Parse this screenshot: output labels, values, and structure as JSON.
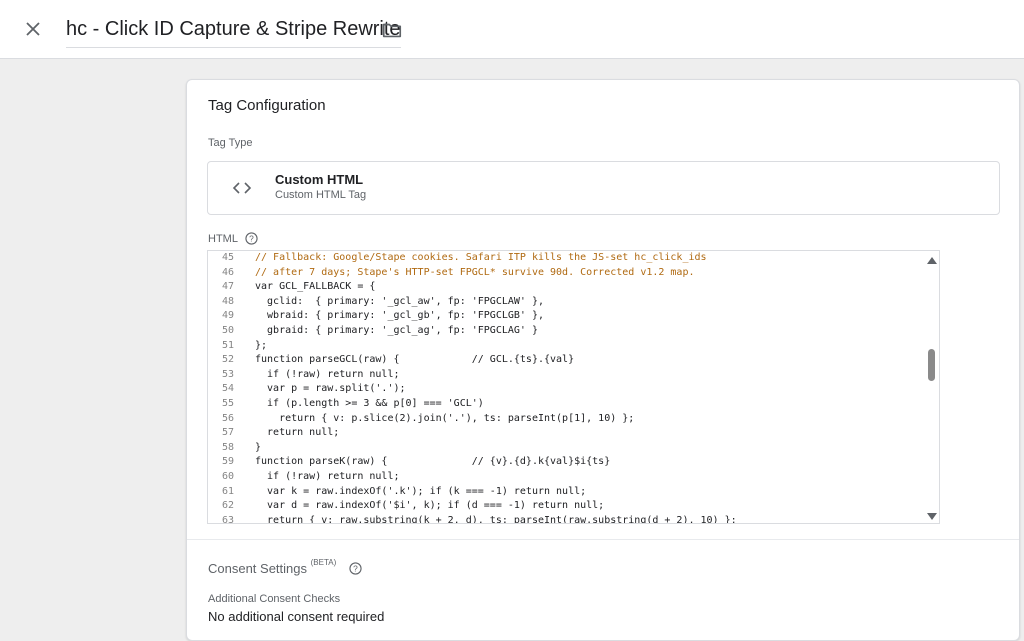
{
  "header": {
    "title": "hc - Click ID Capture & Stripe Rewrite",
    "close_icon": "close-icon",
    "folder_icon": "folder-icon"
  },
  "card": {
    "title": "Tag Configuration",
    "tag_type_label": "Tag Type",
    "tag_type": {
      "name": "Custom HTML",
      "subtitle": "Custom HTML Tag",
      "icon": "code-brackets-icon"
    },
    "html_label": "HTML",
    "editor": {
      "lines": [
        {
          "num": "45",
          "text": "// Fallback: Google/Stape cookies. Safari ITP kills the JS-set hc_click_ids",
          "comment": true
        },
        {
          "num": "46",
          "text": "// after 7 days; Stape's HTTP-set FPGCL* survive 90d. Corrected v1.2 map.",
          "comment": true
        },
        {
          "num": "47",
          "text": "var GCL_FALLBACK = {",
          "comment": false
        },
        {
          "num": "48",
          "text": "  gclid:  { primary: '_gcl_aw', fp: 'FPGCLAW' },",
          "comment": false
        },
        {
          "num": "49",
          "text": "  wbraid: { primary: '_gcl_gb', fp: 'FPGCLGB' },",
          "comment": false
        },
        {
          "num": "50",
          "text": "  gbraid: { primary: '_gcl_ag', fp: 'FPGCLAG' }",
          "comment": false
        },
        {
          "num": "51",
          "text": "};",
          "comment": false
        },
        {
          "num": "52",
          "text": "function parseGCL(raw) {            // GCL.{ts}.{val}",
          "comment": false
        },
        {
          "num": "53",
          "text": "  if (!raw) return null;",
          "comment": false
        },
        {
          "num": "54",
          "text": "  var p = raw.split('.');",
          "comment": false
        },
        {
          "num": "55",
          "text": "  if (p.length >= 3 && p[0] === 'GCL')",
          "comment": false
        },
        {
          "num": "56",
          "text": "    return { v: p.slice(2).join('.'), ts: parseInt(p[1], 10) };",
          "comment": false
        },
        {
          "num": "57",
          "text": "  return null;",
          "comment": false
        },
        {
          "num": "58",
          "text": "}",
          "comment": false
        },
        {
          "num": "59",
          "text": "function parseK(raw) {              // {v}.{d}.k{val}$i{ts}",
          "comment": false
        },
        {
          "num": "60",
          "text": "  if (!raw) return null;",
          "comment": false
        },
        {
          "num": "61",
          "text": "  var k = raw.indexOf('.k'); if (k === -1) return null;",
          "comment": false
        },
        {
          "num": "62",
          "text": "  var d = raw.indexOf('$i', k); if (d === -1) return null;",
          "comment": false
        },
        {
          "num": "63",
          "text": "  return { v: raw.substring(k + 2, d), ts: parseInt(raw.substring(d + 2), 10) };",
          "comment": false
        }
      ],
      "comment_color": "#b06a12",
      "code_color": "#202124"
    },
    "consent": {
      "title": "Consent Settings",
      "beta": "(BETA)",
      "checks_label": "Additional Consent Checks",
      "checks_value": "No additional consent required"
    }
  }
}
